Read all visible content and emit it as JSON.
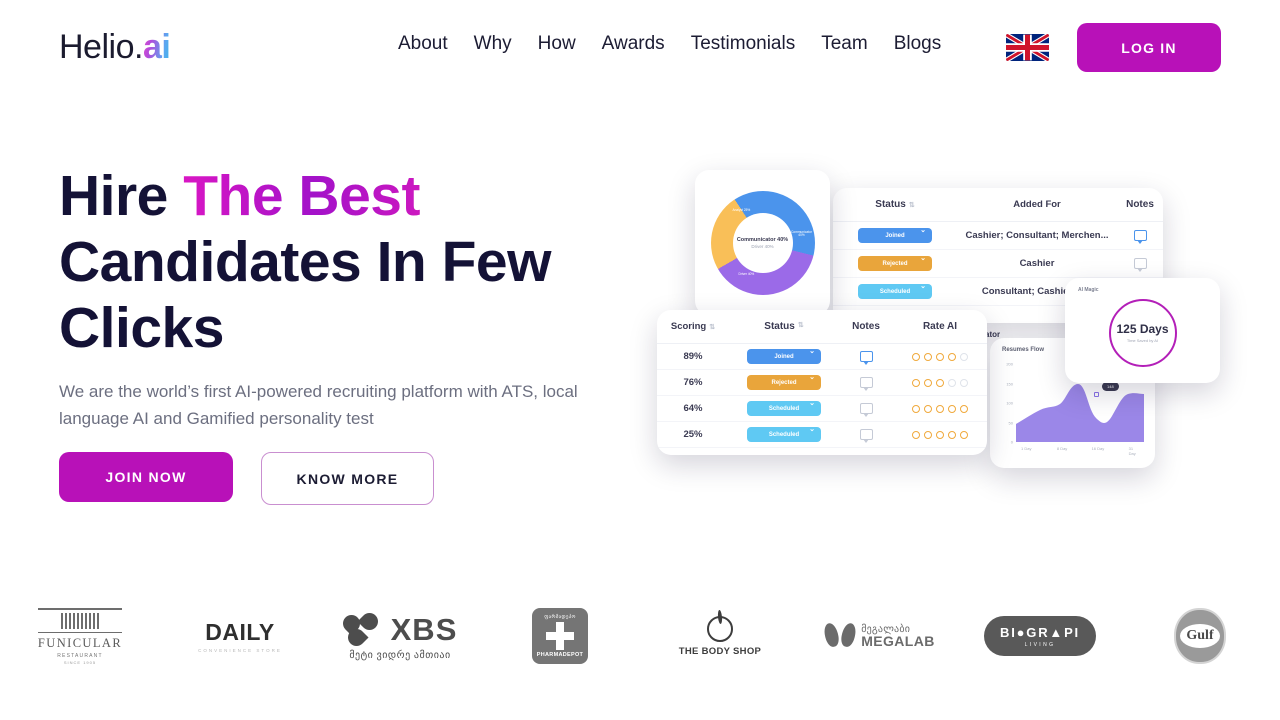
{
  "brand": {
    "name": "Helio.",
    "accent_word": "ai",
    "logo_gradient_start": "#e84bd0",
    "logo_gradient_end": "#3bb6e8"
  },
  "header": {
    "nav": [
      {
        "label": "About"
      },
      {
        "label": "Why"
      },
      {
        "label": "How"
      },
      {
        "label": "Awards"
      },
      {
        "label": "Testimonials"
      },
      {
        "label": "Team"
      },
      {
        "label": "Blogs"
      }
    ],
    "language_flag": "uk-flag-icon",
    "login_label": "LOG IN",
    "login_color": "#b811b8"
  },
  "hero": {
    "title_part1": "Hire ",
    "title_highlight": "The Best",
    "title_part2": "Candidates In Few Clicks",
    "subtitle": "We are  the world’s first AI-powered recruiting platform with ATS, local language AI and Gamified personality test",
    "primary_cta": "JOIN NOW",
    "secondary_cta": "KNOW MORE",
    "highlight_color": "#c116c4"
  },
  "mockup": {
    "donut": {
      "center_line1": "Communicator 40%",
      "center_line2": "Driver 40%",
      "segments": [
        {
          "label": "Communicator 40%",
          "value": 30,
          "color": "#4b94ec"
        },
        {
          "label": "Driver 40%",
          "value": 38,
          "color": "#9b6ae8"
        },
        {
          "label": "Analyst 25%",
          "value": 24,
          "color": "#f9bf58"
        }
      ]
    },
    "top_table": {
      "columns": [
        "Status",
        "Added For",
        "Notes"
      ],
      "rows": [
        {
          "status": "Joined",
          "status_color": "#4b94ec",
          "added_for": "Cashier; Consultant; Merchen...",
          "note": "note-icon"
        },
        {
          "status": "Rejected",
          "status_color": "#e9a53b",
          "added_for": "Cashier",
          "note": "note-icon"
        },
        {
          "status": "Scheduled",
          "status_color": "#5fc9f3",
          "added_for": "Consultant; Cashier-ope",
          "note": "note-icon"
        }
      ],
      "overflow_text": "-operator"
    },
    "score_table": {
      "columns": [
        "Scoring",
        "Status",
        "Notes",
        "Rate AI"
      ],
      "rows": [
        {
          "score": "89%",
          "status": "Joined",
          "status_color": "#4b94ec",
          "rating": 4
        },
        {
          "score": "76%",
          "status": "Rejected",
          "status_color": "#e9a53b",
          "rating": 3
        },
        {
          "score": "64%",
          "status": "Scheduled",
          "status_color": "#5fc9f3",
          "rating": 5
        },
        {
          "score": "25%",
          "status": "Scheduled",
          "status_color": "#5fc9f3",
          "rating": 5
        }
      ]
    },
    "resumes_chart": {
      "title": "Resumes Flow",
      "tooltip": "148",
      "y_ticks": [
        "200",
        "150",
        "100",
        "50",
        "0"
      ],
      "x_ticks": [
        "1 Day",
        "8 Day",
        "16 Day",
        "31 Day"
      ]
    },
    "days_card": {
      "label": "AI Magic",
      "value": "125 Days",
      "caption": "Time Saved by AI",
      "ring_color": "#b31fb8"
    }
  },
  "clients": [
    {
      "name": "FUNICULAR",
      "sub": "RESTAURANT",
      "sub2": "SINCE 1905"
    },
    {
      "name": "DAILY",
      "sub": "CONVENIENCE STORE"
    },
    {
      "name": "XBS",
      "sub": "მეტი ვიდრე ამთიაი"
    },
    {
      "name": "PHARMADEPOT",
      "sub": "ფარმადეპო"
    },
    {
      "name": "THE BODY SHOP",
      "sub": ""
    },
    {
      "name": "MEGALAB",
      "sub": "მეგალაბი"
    },
    {
      "name": "BI●GR▲PI",
      "sub": "LIVING"
    },
    {
      "name": "Gulf",
      "sub": ""
    }
  ]
}
